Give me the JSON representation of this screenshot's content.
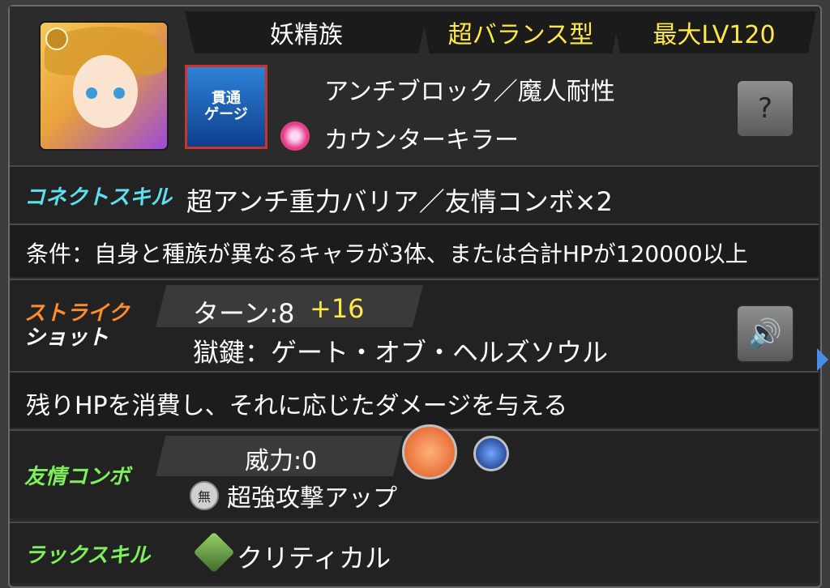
{
  "header": {
    "race": "妖精族",
    "type": "超バランス型",
    "max_level": "最大LV120"
  },
  "icons": {
    "gauge_label_line1": "貫通",
    "gauge_label_line2": "ゲージ"
  },
  "abilities": {
    "line1": "アンチブロック／魔人耐性",
    "line2": "カウンターキラー"
  },
  "connect_skill": {
    "label": "コネクトスキル",
    "name": "超アンチ重力バリア／友情コンボ×2",
    "condition": "条件：自身と種族が異なるキャラが3体、または合計HPが120000以上"
  },
  "strike_shot": {
    "label_line1": "ストライク",
    "label_line2": "ショット",
    "turn_text": "ターン:8",
    "turn_bonus": "+16",
    "name": "獄鍵：ゲート・オブ・ヘルズソウル",
    "description": "残りHPを消費し、それに応じたダメージを与える"
  },
  "friendship": {
    "label": "友情コンボ",
    "power": "威力:0",
    "name": "超強攻撃アップ",
    "badge": "無"
  },
  "luck_skill": {
    "label": "ラックスキル",
    "name": "クリティカル"
  },
  "colors": {
    "connect_label": "#5fe0f0",
    "strike_label": "#ff8c2a",
    "friend_label": "#7ef05a",
    "luck_label": "#7ef05a",
    "highlight": "#ffe84a"
  }
}
